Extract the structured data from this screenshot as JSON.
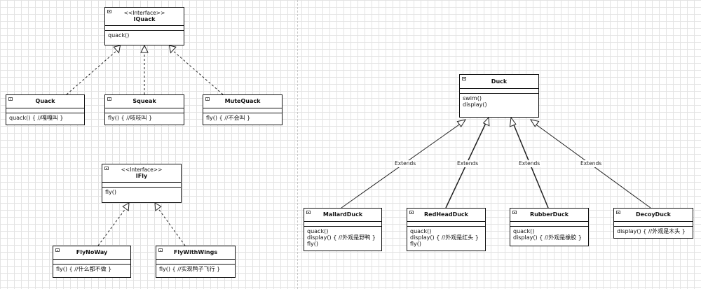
{
  "classes": {
    "iquack": {
      "stereotype": "<<Interface>>",
      "name": "IQuack",
      "ops": [
        "quack()"
      ]
    },
    "quack": {
      "name": "Quack",
      "ops": [
        "quack() { //嘎嘎叫 }"
      ]
    },
    "squeak": {
      "name": "Squeak",
      "ops": [
        "fly() { //吱吱叫 }"
      ]
    },
    "mutequack": {
      "name": "MuteQuack",
      "ops": [
        "fly() { //不会叫 }"
      ]
    },
    "ifly": {
      "stereotype": "<<Interface>>",
      "name": "IFly",
      "ops": [
        "fly()"
      ]
    },
    "flynoway": {
      "name": "FlyNoWay",
      "ops": [
        "fly() { //什么都不做 }"
      ]
    },
    "flywithwings": {
      "name": "FlyWithWings",
      "ops": [
        "fly() { //实现鸭子飞行 }"
      ]
    },
    "duck": {
      "name": "Duck",
      "ops": [
        "swim()",
        "display()"
      ]
    },
    "mallardduck": {
      "name": "MallardDuck",
      "ops": [
        "quack()",
        "display() { //外观是野鸭 }",
        "fly()"
      ]
    },
    "redheadduck": {
      "name": "RedHeadDuck",
      "ops": [
        "quack()",
        "display() { //外观是红头 }",
        "fly()"
      ]
    },
    "rubberduck": {
      "name": "RubberDuck",
      "ops": [
        "quack()",
        "display() { //外观是橡胶 }"
      ]
    },
    "decoyduck": {
      "name": "DecoyDuck",
      "ops": [
        "display() { //外观是木头 }"
      ]
    }
  },
  "edge_labels": {
    "extends": "Extends"
  }
}
